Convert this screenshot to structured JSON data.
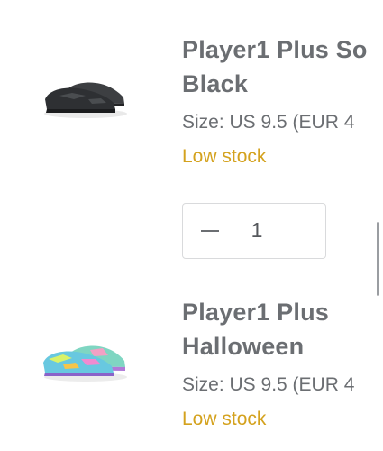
{
  "cart": {
    "items": [
      {
        "name": "Player1 Plus So\nBlack",
        "size": "Size: US 9.5 (EUR 4",
        "stock": "Low stock",
        "quantity": "1",
        "shoe_icon": "black-sneaker-image"
      },
      {
        "name": "Player1 Plus\nHalloween",
        "size": "Size: US 9.5 (EUR 4",
        "stock": "Low stock",
        "shoe_icon": "multicolor-sneaker-image"
      }
    ]
  },
  "colors": {
    "text": "#6b6e72",
    "stock": "#d4a21e",
    "border": "#d9dadc"
  }
}
